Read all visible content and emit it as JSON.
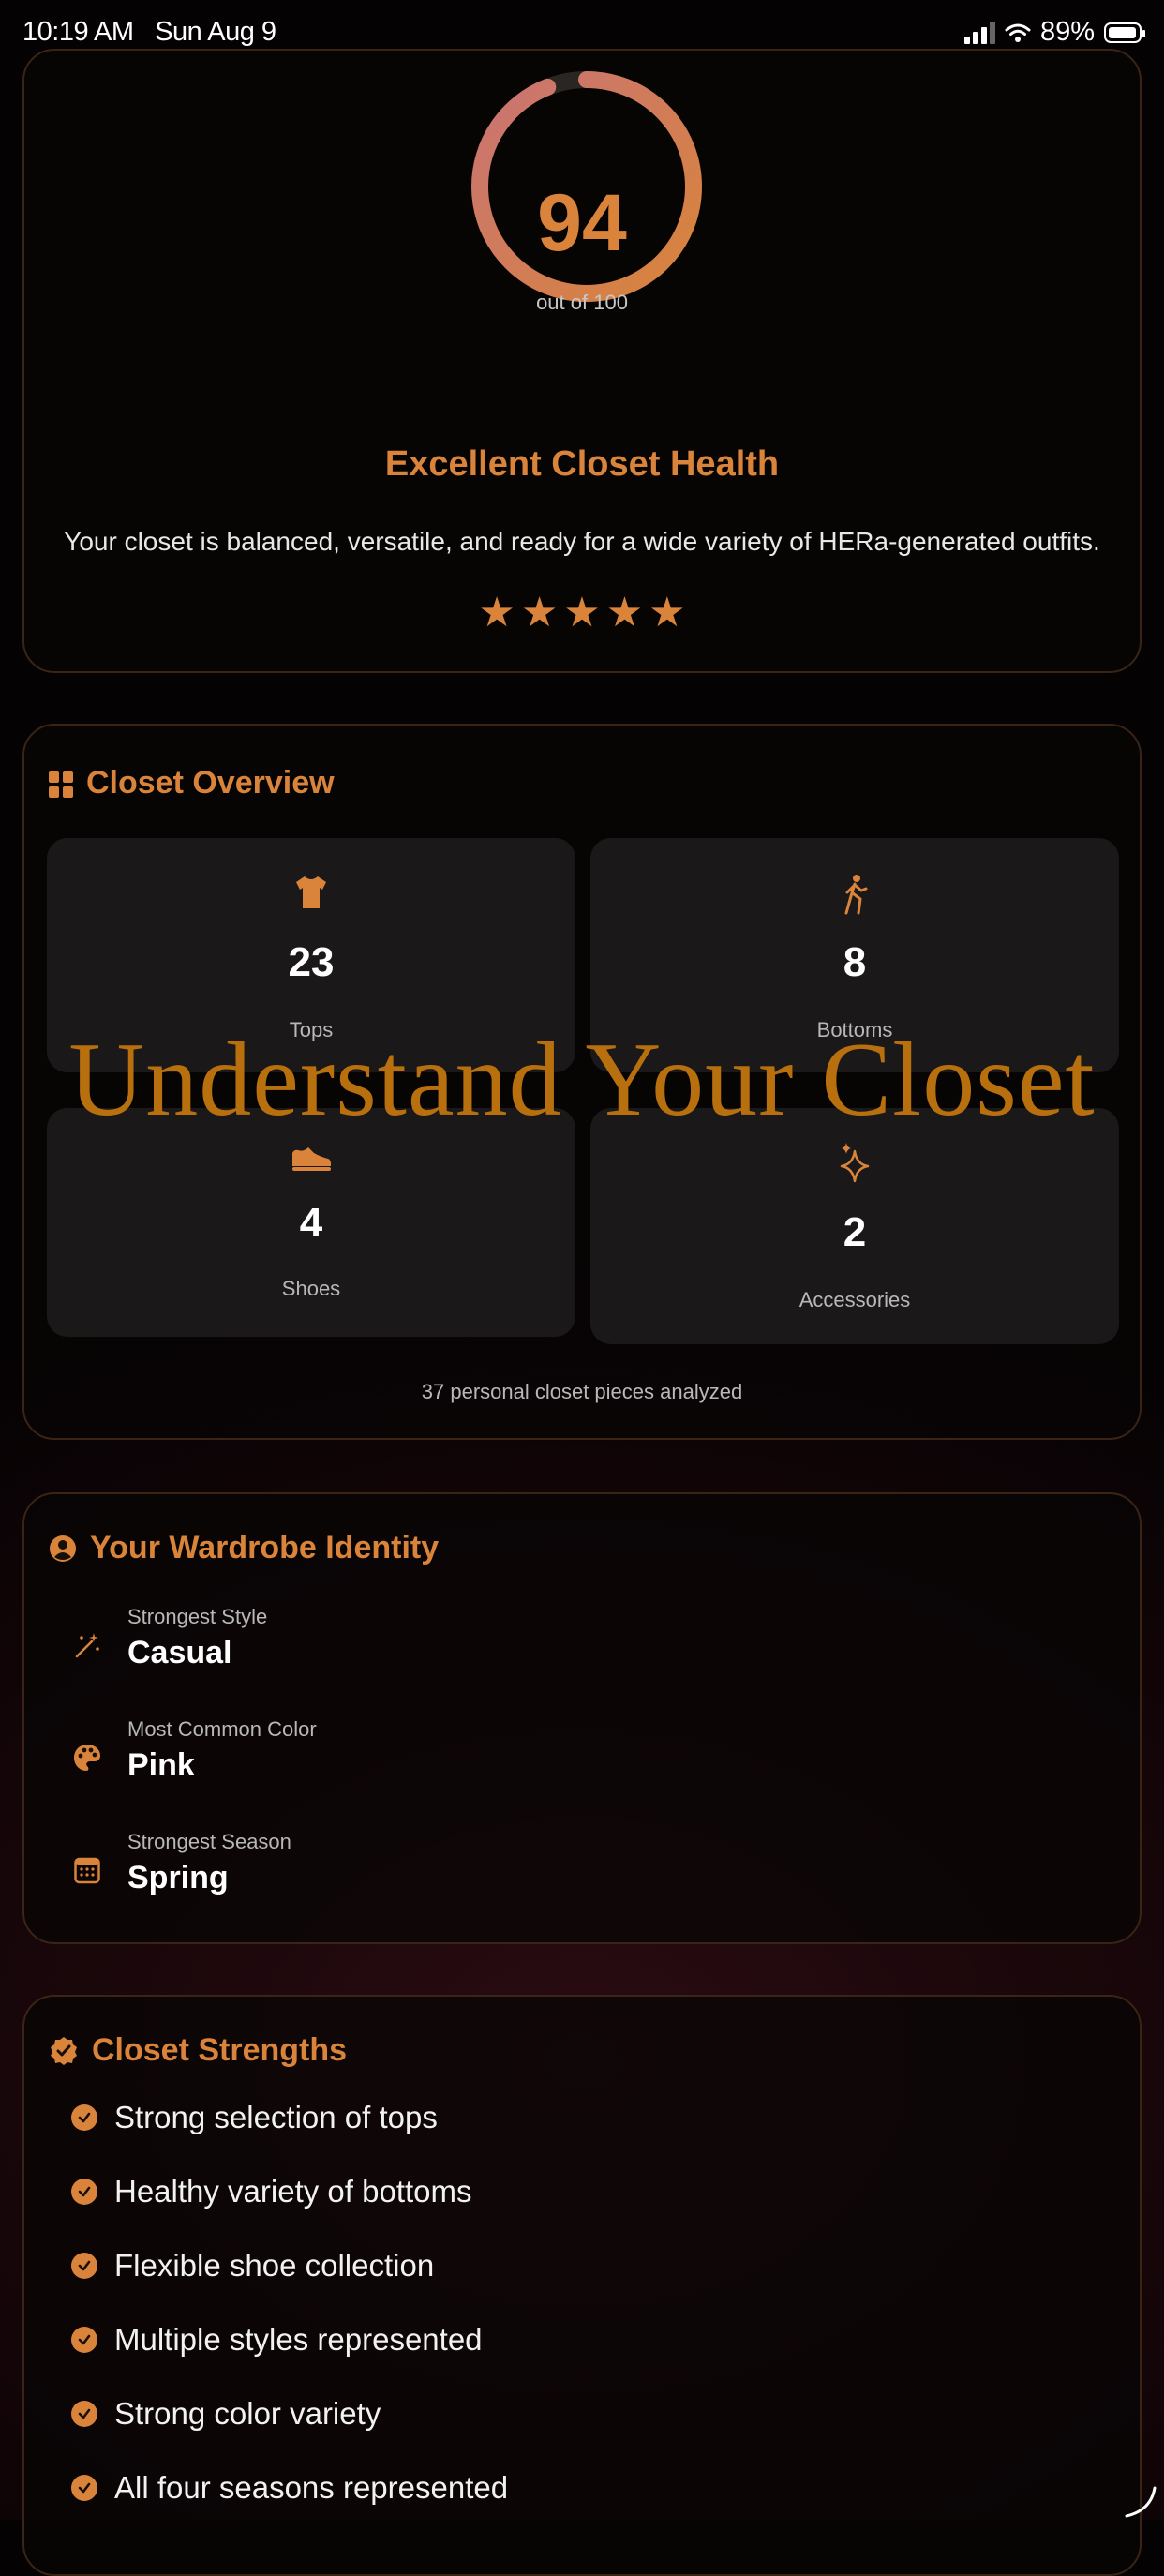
{
  "status_bar": {
    "time": "10:19 AM",
    "date": "Sun Aug 9",
    "battery": "89%",
    "icons": [
      "cellular-signal-icon",
      "wifi-icon",
      "battery-icon"
    ]
  },
  "score_card": {
    "score": "94",
    "score_value": 94,
    "score_max_label": "out of 100",
    "title": "Excellent Closet Health",
    "description": "Your closet is balanced, versatile, and ready for a wide variety of HERa-generated outfits.",
    "stars": 5
  },
  "overview": {
    "title": "Closet Overview",
    "tiles": [
      {
        "count": "23",
        "label": "Tops",
        "icon": "tshirt-icon"
      },
      {
        "count": "8",
        "label": "Bottoms",
        "icon": "walking-figure-icon"
      },
      {
        "count": "4",
        "label": "Shoes",
        "icon": "shoe-icon"
      },
      {
        "count": "2",
        "label": "Accessories",
        "icon": "sparkles-icon"
      }
    ],
    "footer": "37 personal closet pieces analyzed"
  },
  "watermark": "Understand Your Closet",
  "identity": {
    "title": "Your Wardrobe Identity",
    "rows": [
      {
        "label": "Strongest Style",
        "value": "Casual",
        "icon": "magic-wand-icon"
      },
      {
        "label": "Most Common Color",
        "value": "Pink",
        "icon": "palette-icon"
      },
      {
        "label": "Strongest Season",
        "value": "Spring",
        "icon": "calendar-icon"
      }
    ]
  },
  "strengths": {
    "title": "Closet Strengths",
    "items": [
      "Strong selection of tops",
      "Healthy variety of bottoms",
      "Flexible shoe collection",
      "Multiple styles represented",
      "Strong color variety",
      "All four seasons represented"
    ]
  },
  "colors": {
    "accent": "#d9843a",
    "ring_gradient_end": "#c97474",
    "card_border": "#3a2415",
    "tile_bg": "#1a1818"
  }
}
